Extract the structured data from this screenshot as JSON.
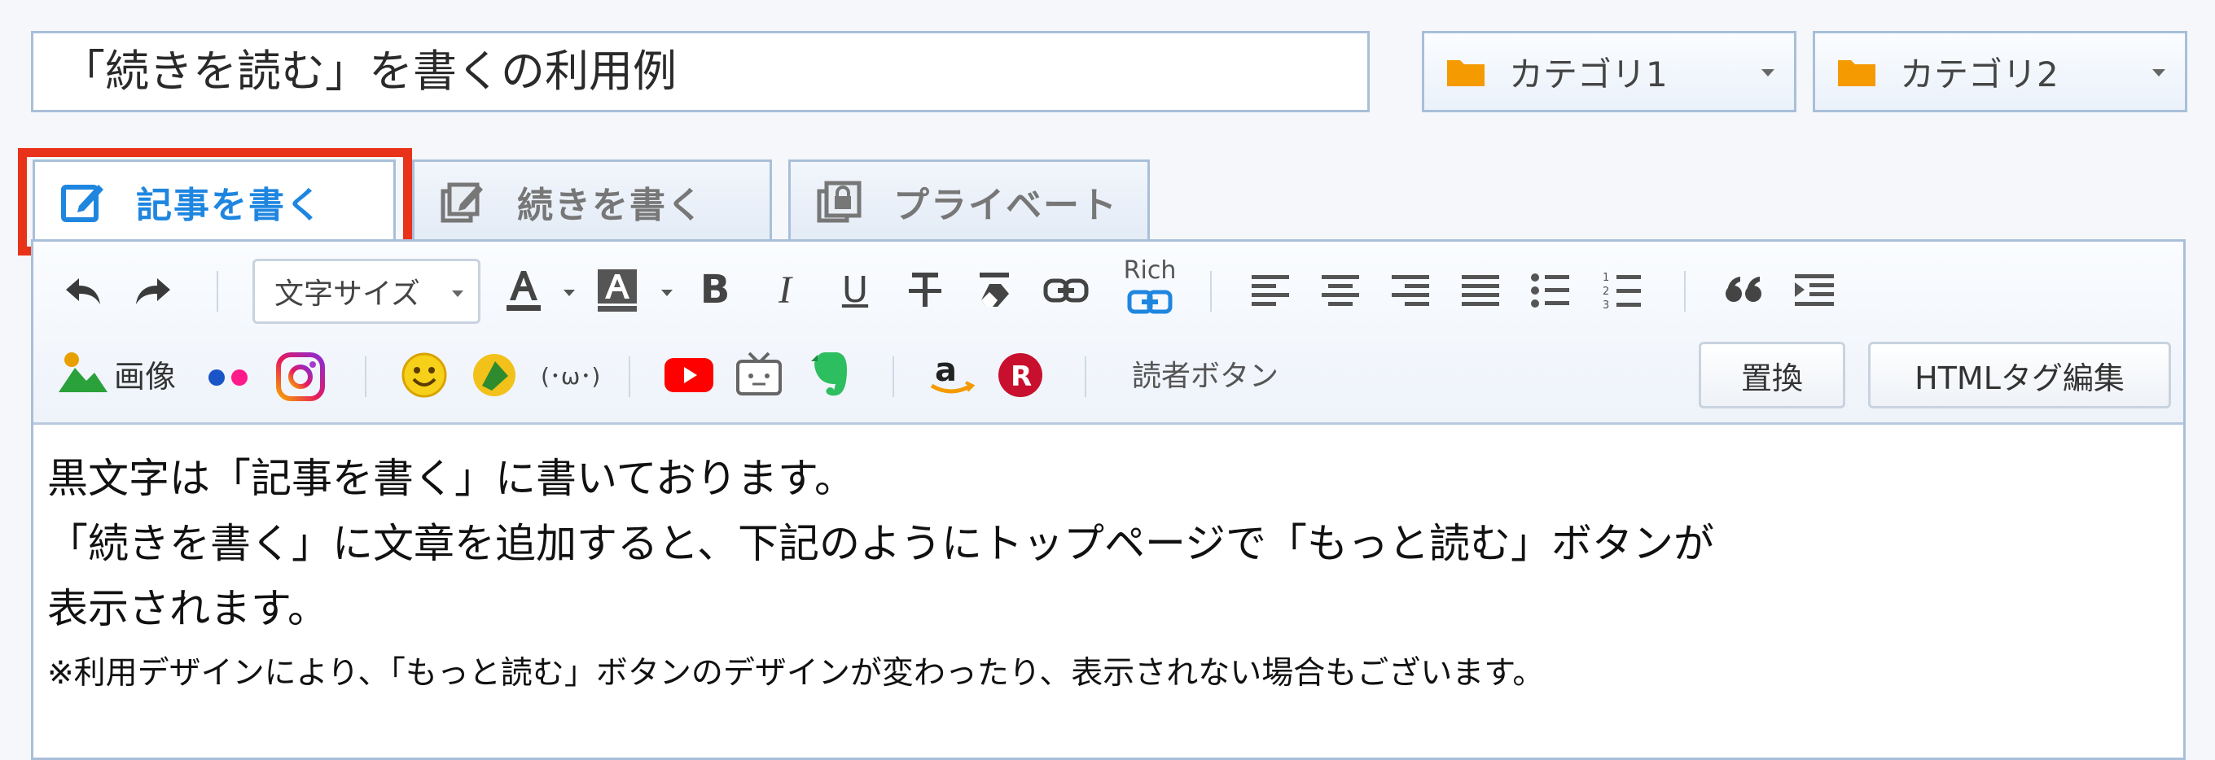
{
  "title_input": {
    "value": "「続きを読む」を書くの利用例"
  },
  "categories": [
    {
      "label": "カテゴリ1"
    },
    {
      "label": "カテゴリ2"
    }
  ],
  "tabs": [
    {
      "label": "記事を書く",
      "active": true
    },
    {
      "label": "続きを書く",
      "active": false
    },
    {
      "label": "プライベート",
      "active": false
    }
  ],
  "toolbar": {
    "font_size_label": "文字サイズ",
    "bold": "B",
    "italic": "I",
    "underline": "U",
    "rich_label": "Rich",
    "image_label": "画像",
    "emoticon_label": "(･ω･)",
    "reader_button_label": "読者ボタン",
    "replace_button": "置換",
    "html_edit_button": "HTMLタグ編集"
  },
  "body": {
    "line1": "黒文字は「記事を書く」に書いております。",
    "line2": "「続きを書く」に文章を追加すると、下記のようにトップページで「もっと読む」ボタンが",
    "line3": "表示されます。",
    "note": "※利用デザインにより、「もっと読む」ボタンのデザインが変わったり、表示されない場合もございます。"
  },
  "colors": {
    "accent_blue": "#1f86e0",
    "highlight_red": "#e8321a",
    "folder_orange": "#f59a00"
  }
}
